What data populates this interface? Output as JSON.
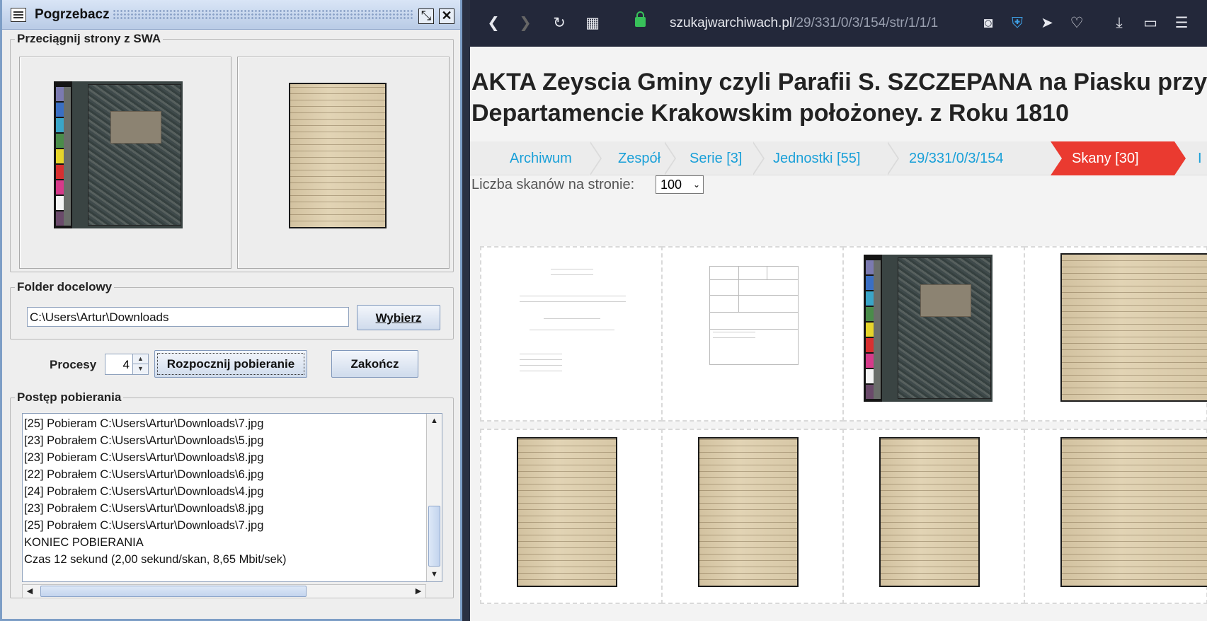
{
  "app": {
    "title": "Pogrzebacz",
    "section_drag": "Przeciągnij strony z SWA",
    "section_folder": "Folder docelowy",
    "folder_path": "C:\\Users\\Artur\\Downloads",
    "choose_button": "Wybierz",
    "processes_label": "Procesy",
    "processes_value": "4",
    "start_button": "Rozpocznij pobieranie",
    "end_button": "Zakończ",
    "section_progress": "Postęp pobierania",
    "log": [
      "[25] Pobieram C:\\Users\\Artur\\Downloads\\7.jpg",
      "[23] Pobrałem C:\\Users\\Artur\\Downloads\\5.jpg",
      "[23] Pobieram C:\\Users\\Artur\\Downloads\\8.jpg",
      "[22] Pobrałem C:\\Users\\Artur\\Downloads\\6.jpg",
      "[24] Pobrałem C:\\Users\\Artur\\Downloads\\4.jpg",
      "[23] Pobrałem C:\\Users\\Artur\\Downloads\\8.jpg",
      "[25] Pobrałem C:\\Users\\Artur\\Downloads\\7.jpg",
      "KONIEC POBIERANIA",
      "Czas 12 sekund (2,00 sekund/skan, 8,65 Mbit/sek)"
    ]
  },
  "browser": {
    "url_domain": "szukajwarchiwach.pl",
    "url_path": "/29/331/0/3/154/str/1/1/1",
    "title_line1": "AKTA Zeyscia Gminy czyli Parafii S. SZCZEPANA na Piasku przy K",
    "title_line2": "Departamencie Krakowskim położoney. z Roku 1810",
    "breadcrumbs": [
      "Archiwum",
      "Zespół",
      "Serie [3]",
      "Jednostki [55]",
      "29/331/0/3/154"
    ],
    "breadcrumb_active": "Skany [30]",
    "breadcrumb_next": "I",
    "per_page_label": "Liczba skanów na stronie:",
    "per_page_value": "100",
    "accent_color": "#ea3a30",
    "link_color": "#1aa0d8"
  }
}
